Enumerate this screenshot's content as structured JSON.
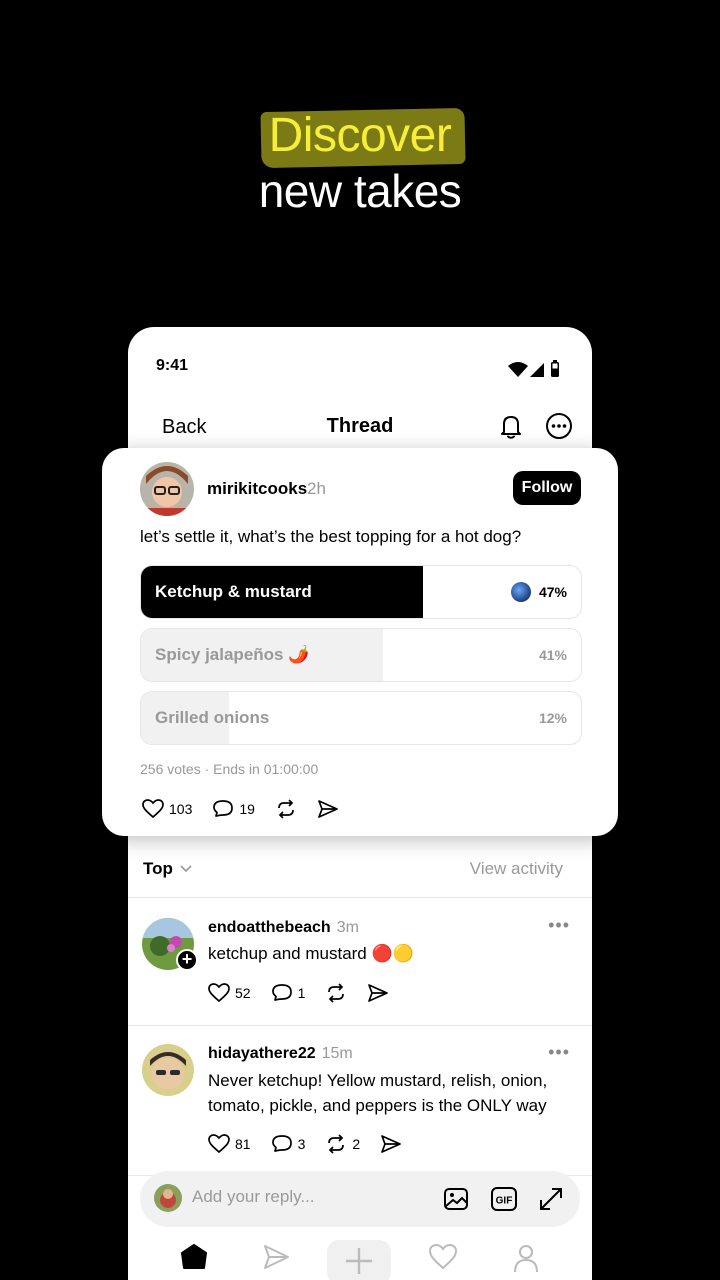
{
  "headline": {
    "line1": "Discover",
    "line2": "new takes"
  },
  "status_bar": {
    "time": "9:41"
  },
  "nav": {
    "back": "Back",
    "title": "Thread"
  },
  "post": {
    "username": "mirikitcooks",
    "time": "2h",
    "follow": "Follow",
    "text": "let’s settle it, what’s the best topping for a hot dog?",
    "poll": [
      {
        "label": "Ketchup & mustard",
        "percent": "47%",
        "share": 0.64,
        "selected": true
      },
      {
        "label": "Spicy jalapeños 🌶️",
        "percent": "41%",
        "share": 0.55,
        "selected": false
      },
      {
        "label": "Grilled onions",
        "percent": "12%",
        "share": 0.2,
        "selected": false
      }
    ],
    "meta": "256 votes · Ends in 01:00:00",
    "likes": "103",
    "replies": "19"
  },
  "sort": {
    "label": "Top",
    "view_activity": "View activity"
  },
  "replies": [
    {
      "username": "endoatthebeach",
      "time": "3m",
      "text": "ketchup and mustard 🔴🟡",
      "likes": "52",
      "replies": "1"
    },
    {
      "username": "hidayathere22",
      "time": "15m",
      "text": "Never ketchup! Yellow mustard, relish, onion, tomato, pickle, and peppers is the ONLY way",
      "likes": "81",
      "replies": "3",
      "reposts": "2"
    }
  ],
  "reply_bar": {
    "placeholder": "Add your reply..."
  },
  "colors": {
    "highlight": "#f5ef3a",
    "muted": "#999999",
    "poll_fill": "#000000",
    "poll_fill_light": "#f1f1f1"
  }
}
